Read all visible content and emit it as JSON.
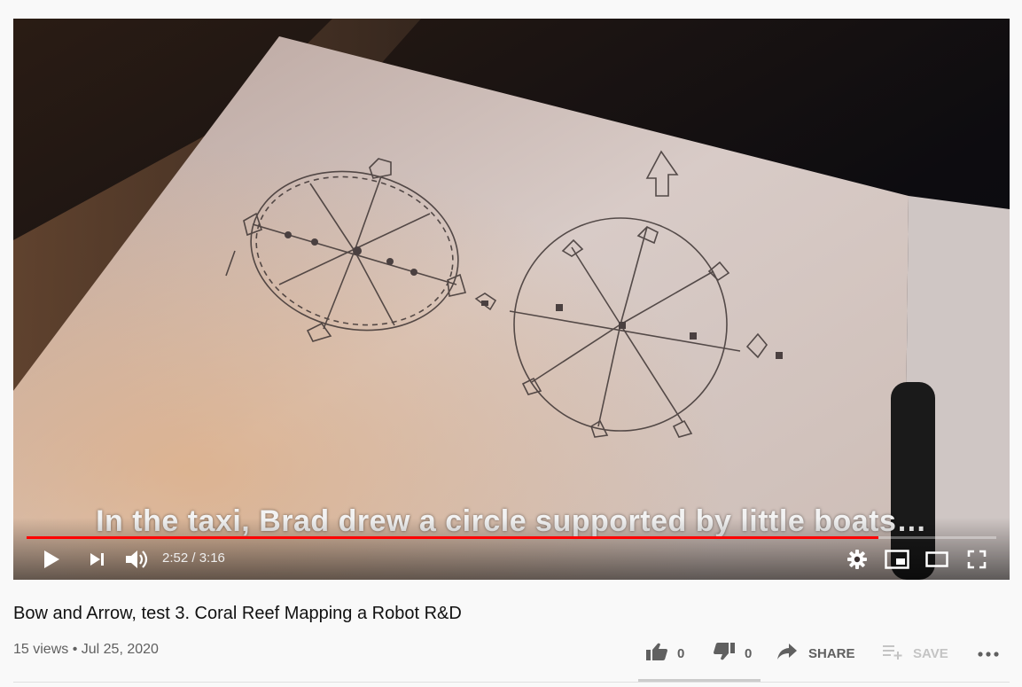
{
  "player": {
    "caption": "In the taxi, Brad drew a circle supported by little boats…",
    "current_time": "2:52",
    "duration": "3:16",
    "time_display": "2:52 / 3:16",
    "progress": 0.878,
    "controls": {
      "play": "play-icon",
      "next": "next-icon",
      "volume": "volume-icon",
      "settings": "gear-icon",
      "miniplayer": "miniplayer-icon",
      "theater": "theater-icon",
      "fullscreen": "fullscreen-icon"
    },
    "accent": "#ff0000"
  },
  "video": {
    "title": "Bow and Arrow, test 3. Coral Reef Mapping a Robot R&D",
    "views": "15 views",
    "separator": "•",
    "date": "Jul 25, 2020",
    "meta_line": "15 views • Jul 25, 2020"
  },
  "actions": {
    "likes": "0",
    "dislikes": "0",
    "share": "SHARE",
    "save": "SAVE",
    "more": "more-icon"
  }
}
